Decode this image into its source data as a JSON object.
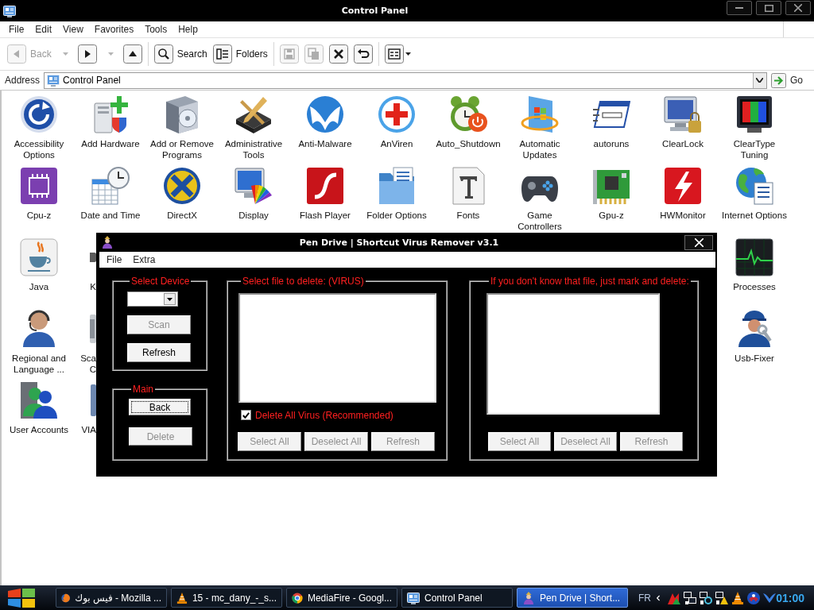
{
  "window": {
    "title": "Control Panel"
  },
  "menu": [
    "File",
    "Edit",
    "View",
    "Favorites",
    "Tools",
    "Help"
  ],
  "toolbar": [
    {
      "kind": "back",
      "label": "Back",
      "disabled": true
    },
    {
      "kind": "caret",
      "disabled": true
    },
    {
      "kind": "forward",
      "disabled": false
    },
    {
      "kind": "caret",
      "disabled": true
    },
    {
      "kind": "up",
      "disabled": false
    },
    {
      "kind": "separator"
    },
    {
      "kind": "search",
      "label": "Search",
      "disabled": false
    },
    {
      "kind": "folders",
      "label": "Folders",
      "disabled": false
    },
    {
      "kind": "separator"
    },
    {
      "kind": "save",
      "disabled": true
    },
    {
      "kind": "copy",
      "disabled": true
    },
    {
      "kind": "delete",
      "disabled": false
    },
    {
      "kind": "undo",
      "disabled": false
    },
    {
      "kind": "separator"
    },
    {
      "kind": "views",
      "disabled": false
    }
  ],
  "address": {
    "label": "Address",
    "value": "Control Panel",
    "go": "Go"
  },
  "icons": [
    [
      {
        "kind": "applet",
        "label": "Accessibility Options"
      },
      {
        "kind": "applet",
        "label": "Add Hardware"
      },
      {
        "kind": "applet",
        "label": "Add or Remove Programs"
      },
      {
        "kind": "applet",
        "label": "Administrative Tools"
      },
      {
        "kind": "applet",
        "label": "Anti-Malware"
      },
      {
        "kind": "applet",
        "label": "AnViren"
      },
      {
        "kind": "applet",
        "label": "Auto_Shutdown"
      },
      {
        "kind": "applet",
        "label": "Automatic Updates"
      },
      {
        "kind": "applet",
        "label": "autoruns"
      },
      {
        "kind": "applet",
        "label": "ClearLock"
      },
      {
        "kind": "applet",
        "label": "ClearType Tuning"
      }
    ],
    [
      {
        "kind": "applet",
        "label": "Cpu-z"
      },
      {
        "kind": "applet",
        "label": "Date and Time"
      },
      {
        "kind": "applet",
        "label": "DirectX"
      },
      {
        "kind": "applet",
        "label": "Display"
      },
      {
        "kind": "applet",
        "label": "Flash Player"
      },
      {
        "kind": "applet",
        "label": "Folder Options"
      },
      {
        "kind": "applet",
        "label": "Fonts"
      },
      {
        "kind": "applet",
        "label": "Game Controllers"
      },
      {
        "kind": "applet",
        "label": "Gpu-z"
      },
      {
        "kind": "applet",
        "label": "HWMonitor"
      },
      {
        "kind": "applet",
        "label": "Internet Options"
      }
    ],
    [
      {
        "kind": "applet",
        "label": "Java"
      },
      {
        "kind": "cut",
        "lines": [
          "K"
        ]
      },
      {
        "kind": "applet",
        "label": "Processes"
      }
    ],
    [
      {
        "kind": "applet",
        "label": "Regional and Language ..."
      },
      {
        "kind": "cut",
        "lines": [
          "Sca",
          "C"
        ]
      },
      {
        "kind": "applet",
        "label": "Usb-Fixer"
      }
    ],
    [
      {
        "kind": "applet",
        "label": "User Accounts"
      },
      {
        "kind": "cut",
        "lines": [
          "VIA"
        ]
      }
    ]
  ],
  "dialog": {
    "title": "Pen Drive | Shortcut Virus Remover v3.1",
    "menu": [
      "File",
      "Extra"
    ],
    "device_group": {
      "title": "Select Device",
      "buttons": [
        {
          "label": "Scan",
          "disabled": true
        },
        {
          "label": "Refresh",
          "disabled": false
        }
      ]
    },
    "main_group": {
      "title": "Main",
      "buttons": [
        {
          "label": "Back",
          "disabled": false,
          "focused": true
        },
        {
          "label": "Delete",
          "disabled": true,
          "focused": false
        }
      ]
    },
    "virus_group": {
      "title": "Select file to delete: (VIRUS)",
      "checkbox": {
        "label": "Delete All Virus (Recommended)",
        "checked": true
      },
      "buttons": [
        {
          "label": "Select All",
          "disabled": true
        },
        {
          "label": "Deselect All",
          "disabled": true
        },
        {
          "label": "Refresh",
          "disabled": true
        }
      ]
    },
    "unknown_group": {
      "title": "If you don't know that file, just mark and delete:",
      "buttons": [
        {
          "label": "Select All",
          "disabled": true
        },
        {
          "label": "Deselect All",
          "disabled": true
        },
        {
          "label": "Refresh",
          "disabled": true
        }
      ]
    }
  },
  "taskbar": {
    "tasks": [
      {
        "label": "فيس بوك - Mozilla ...",
        "selected": false
      },
      {
        "label": "15 - mc_dany_-_s...",
        "selected": false
      },
      {
        "label": "MediaFire - Googl...",
        "selected": false
      },
      {
        "label": "Control Panel",
        "selected": false
      },
      {
        "label": "Pen Drive | Short...",
        "selected": true
      }
    ],
    "language": "FR",
    "clock": "01:00"
  }
}
